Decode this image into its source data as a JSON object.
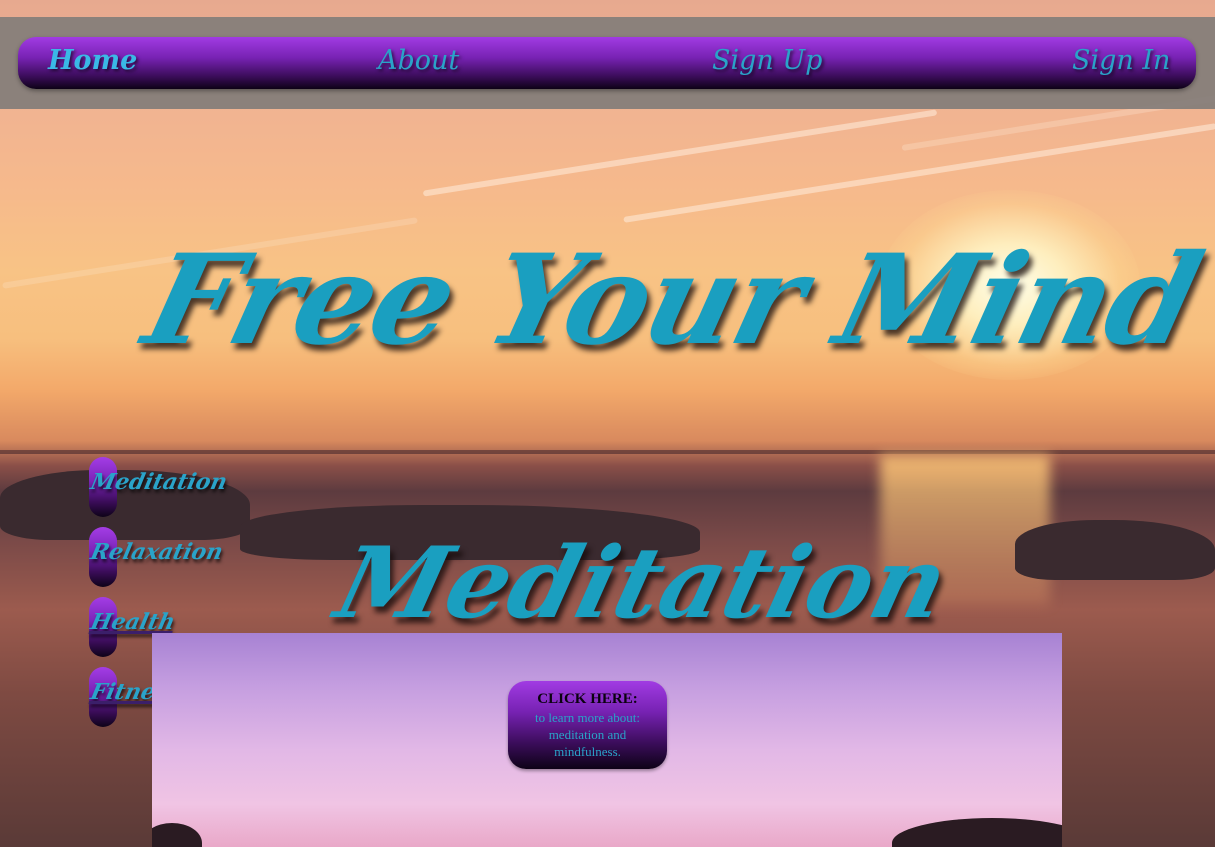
{
  "nav": {
    "home": "Home",
    "about": "About",
    "signup": "Sign Up",
    "signin": "Sign In"
  },
  "hero": {
    "title": "Free Your Mind",
    "section_title": "Meditation"
  },
  "sidebar": {
    "items": [
      {
        "label": "Meditation"
      },
      {
        "label": "Relaxation"
      },
      {
        "label": "Health"
      },
      {
        "label": "Fitness"
      }
    ]
  },
  "cta": {
    "heading": "CLICK HERE:",
    "body": "to learn more about: meditation and mindfulness."
  },
  "colors": {
    "accent_text": "#1a9fc0",
    "button_top": "#a13be3",
    "button_bottom": "#0d0216"
  }
}
